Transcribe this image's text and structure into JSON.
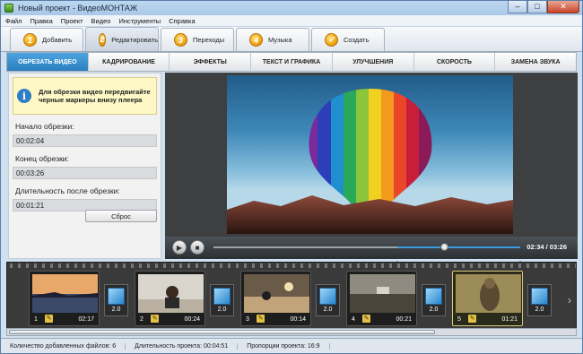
{
  "window": {
    "title": "Новый проект - ВидеоМОНТАЖ",
    "minimize": "–",
    "maximize": "□",
    "close": "✕"
  },
  "menu": [
    "Файл",
    "Правка",
    "Проект",
    "Видео",
    "Инструменты",
    "Справка"
  ],
  "steps": [
    {
      "num": "1",
      "label": "Добавить"
    },
    {
      "num": "2",
      "label": "Редактировать",
      "active": true
    },
    {
      "num": "3",
      "label": "Переходы"
    },
    {
      "num": "4",
      "label": "Музыка"
    },
    {
      "num": "✓",
      "label": "Создать"
    }
  ],
  "tabs": [
    "ОБРЕЗАТЬ ВИДЕО",
    "КАДРИРОВАНИЕ",
    "ЭФФЕКТЫ",
    "ТЕКСТ И ГРАФИКА",
    "УЛУЧШЕНИЯ",
    "СКОРОСТЬ",
    "ЗАМЕНА ЗВУКА"
  ],
  "trim": {
    "hint": "Для обрезки видео передвигайте черные маркеры внизу плеера",
    "start_label": "Начало обрезки:",
    "start_value": "00:02:04",
    "end_label": "Конец обрезки:",
    "end_value": "00:03:26",
    "duration_label": "Длительность после обрезки:",
    "duration_value": "00:01:21",
    "reset": "Сброс"
  },
  "player": {
    "timecode": "02:34 / 03:26",
    "progress": 0.75,
    "trim_start": 0.6,
    "trim_end": 1.0
  },
  "clips": [
    {
      "num": "1",
      "dur": "02:17",
      "trans": "2.0"
    },
    {
      "num": "2",
      "dur": "00:24",
      "trans": "2.0"
    },
    {
      "num": "3",
      "dur": "00:14",
      "trans": "2.0"
    },
    {
      "num": "4",
      "dur": "00:21",
      "trans": "2.0"
    },
    {
      "num": "5",
      "dur": "01:21",
      "trans": "2.0",
      "selected": true
    }
  ],
  "status": {
    "files": "Количество добавленных файлов: 6",
    "duration": "Длительность проекта: 00:04:51",
    "aspect": "Пропорции проекта: 16:9"
  }
}
